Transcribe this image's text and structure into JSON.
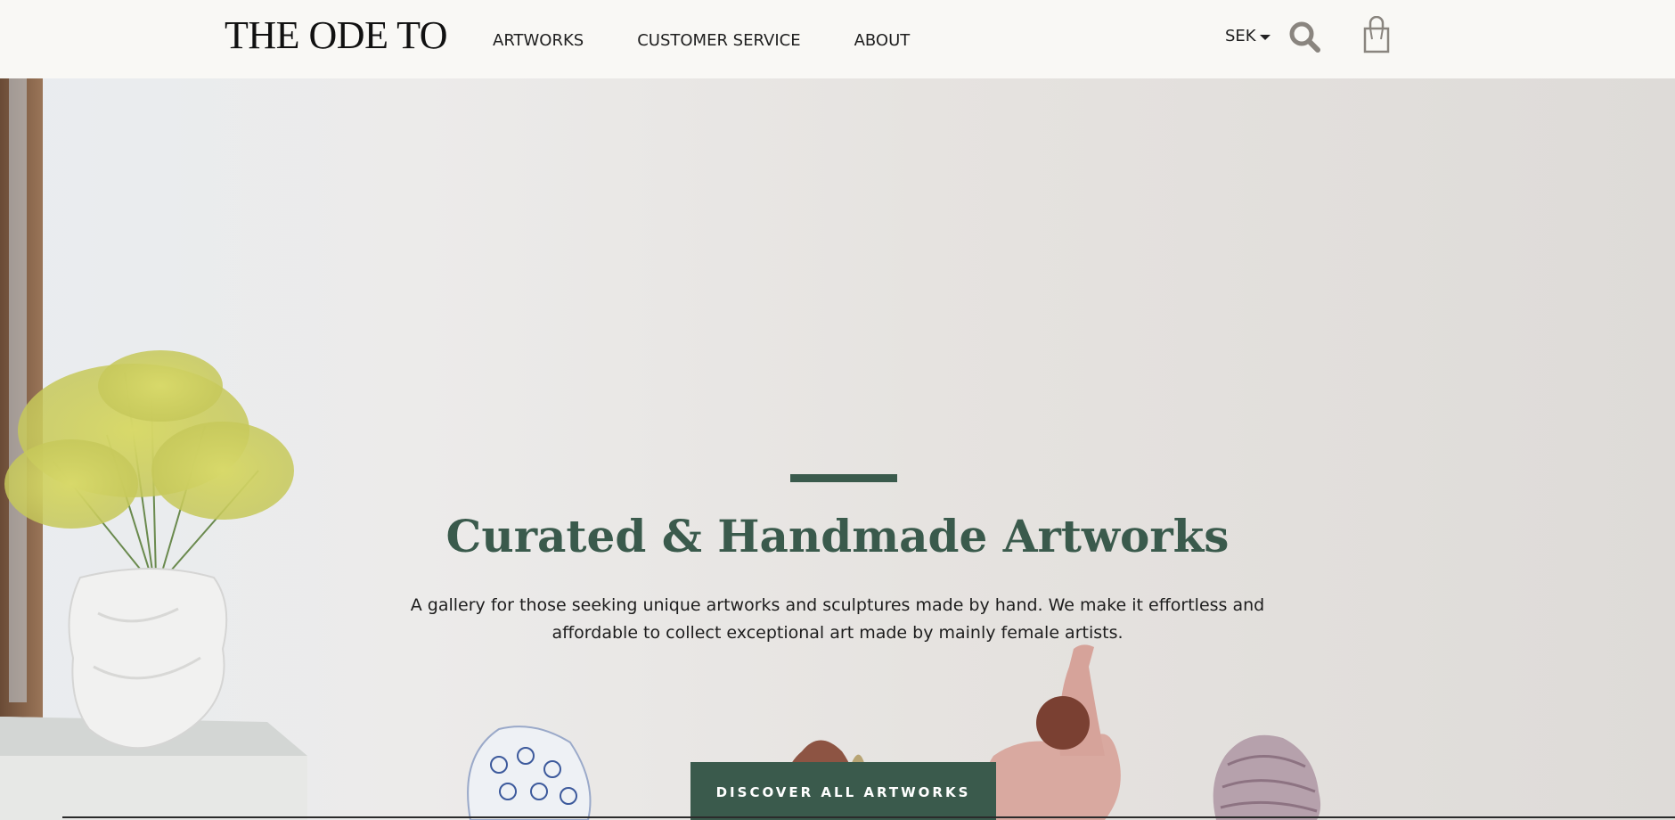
{
  "header": {
    "logo": "THE ODE TO",
    "nav": [
      {
        "label": "ARTWORKS"
      },
      {
        "label": "CUSTOMER SERVICE"
      },
      {
        "label": "ABOUT"
      }
    ],
    "currency": "SEK",
    "icons": {
      "search": "search-icon",
      "cart": "shopping-bag-icon",
      "currency_dropdown": "caret-down-icon"
    }
  },
  "hero": {
    "title": "Curated & Handmade Artworks",
    "subtitle": "A gallery for those seeking unique artworks and sculptures made by hand. We make it effortless and affordable to collect exceptional art made by mainly female artists.",
    "cta_label": "DISCOVER ALL ARTWORKS"
  },
  "colors": {
    "accent": "#3a5a4c",
    "header_bg": "#f9f8f5",
    "text": "#1d1d1d",
    "icon_gray": "#8a857f"
  }
}
